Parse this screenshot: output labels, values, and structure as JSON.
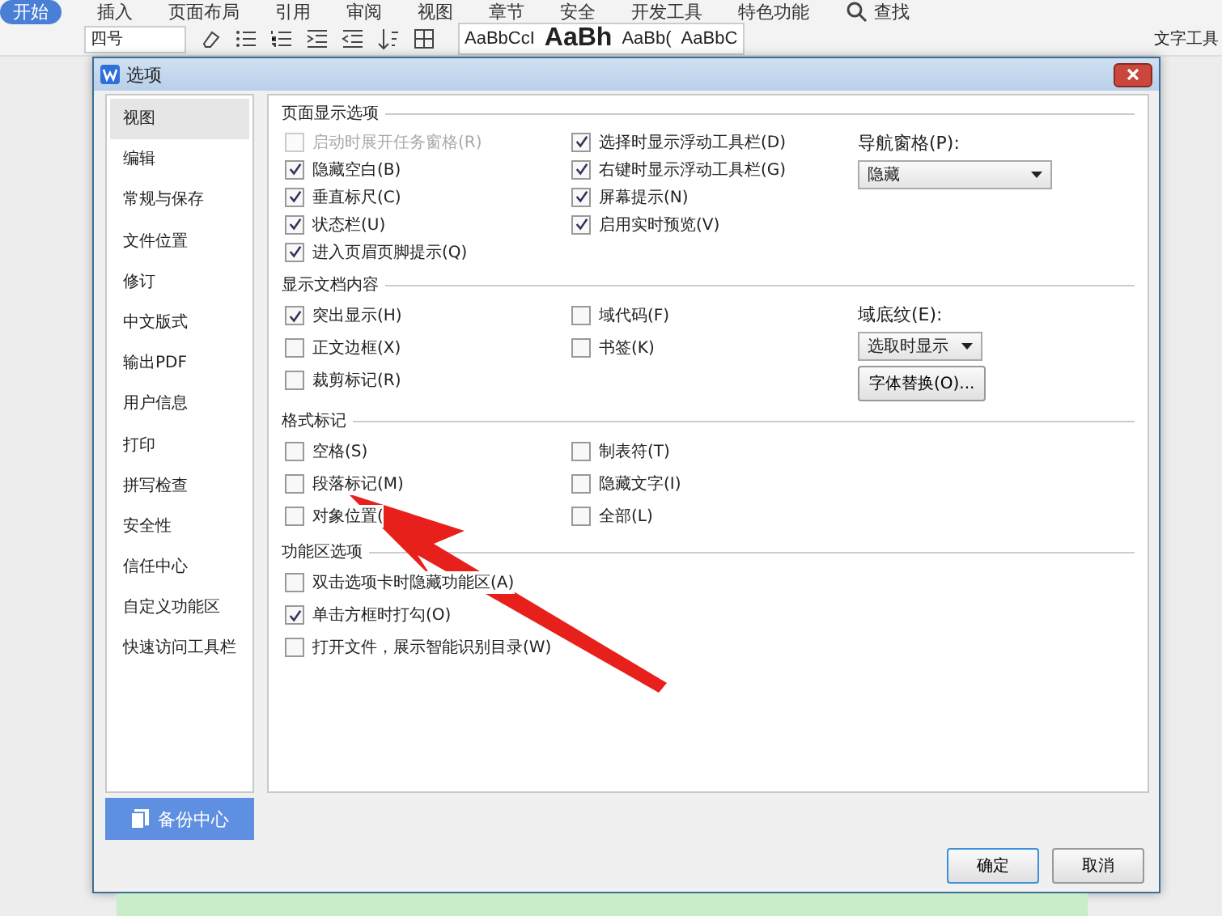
{
  "ribbon": {
    "tabs": [
      {
        "label": "开始",
        "selected": true
      },
      {
        "label": "插入",
        "selected": false
      },
      {
        "label": "页面布局",
        "selected": false
      },
      {
        "label": "引用",
        "selected": false
      },
      {
        "label": "审阅",
        "selected": false
      },
      {
        "label": "视图",
        "selected": false
      },
      {
        "label": "章节",
        "selected": false
      },
      {
        "label": "安全",
        "selected": false
      },
      {
        "label": "开发工具",
        "selected": false
      },
      {
        "label": "特色功能",
        "selected": false
      }
    ],
    "search": "查找",
    "font_size": "四号",
    "styles": [
      "AaBbCcI",
      "AaBh",
      "AaBb(",
      "AaBbC"
    ],
    "tool": "文字工具"
  },
  "dialog": {
    "title": "选项",
    "nav": [
      {
        "label": "视图",
        "selected": true
      },
      {
        "label": "编辑",
        "selected": false
      },
      {
        "label": "常规与保存",
        "selected": false
      },
      {
        "label": "文件位置",
        "selected": false
      },
      {
        "label": "修订",
        "selected": false
      },
      {
        "label": "中文版式",
        "selected": false
      },
      {
        "label": "输出PDF",
        "selected": false
      },
      {
        "label": "用户信息",
        "selected": false
      },
      {
        "label": "打印",
        "selected": false
      },
      {
        "label": "拼写检查",
        "selected": false
      },
      {
        "label": "安全性",
        "selected": false
      },
      {
        "label": "信任中心",
        "selected": false
      },
      {
        "label": "自定义功能区",
        "selected": false
      },
      {
        "label": "快速访问工具栏",
        "selected": false
      }
    ],
    "backup_button": "备份中心",
    "sections": [
      {
        "title": "页面显示选项",
        "columns": [
          [
            {
              "label": "启动时展开任务窗格(R)",
              "checked": false,
              "disabled": true
            },
            {
              "label": "隐藏空白(B)",
              "checked": true,
              "disabled": false
            },
            {
              "label": "垂直标尺(C)",
              "checked": true,
              "disabled": false
            },
            {
              "label": "状态栏(U)",
              "checked": true,
              "disabled": false
            },
            {
              "label": "进入页眉页脚提示(Q)",
              "checked": true,
              "disabled": false
            }
          ],
          [
            {
              "label": "选择时显示浮动工具栏(D)",
              "checked": true,
              "disabled": false
            },
            {
              "label": "右键时显示浮动工具栏(G)",
              "checked": true,
              "disabled": false
            },
            {
              "label": "屏幕提示(N)",
              "checked": true,
              "disabled": false
            },
            {
              "label": "启用实时预览(V)",
              "checked": true,
              "disabled": false
            }
          ]
        ],
        "side": [
          {
            "kind": "label",
            "text": "导航窗格(P):"
          },
          {
            "kind": "dropdown",
            "text": "隐藏"
          }
        ]
      },
      {
        "title": "显示文档内容",
        "columns": [
          [
            {
              "label": "突出显示(H)",
              "checked": true,
              "disabled": false
            },
            {
              "label": "正文边框(X)",
              "checked": false,
              "disabled": false
            },
            {
              "label": "裁剪标记(R)",
              "checked": false,
              "disabled": false
            }
          ],
          [
            {
              "label": "域代码(F)",
              "checked": false,
              "disabled": false
            },
            {
              "label": "书签(K)",
              "checked": false,
              "disabled": false
            }
          ]
        ],
        "side": [
          {
            "kind": "label",
            "text": "域底纹(E):"
          },
          {
            "kind": "dropdown",
            "text": "选取时显示"
          },
          {
            "kind": "button",
            "text": "字体替换(O)..."
          }
        ]
      },
      {
        "title": "格式标记",
        "columns": [
          [
            {
              "label": "空格(S)",
              "checked": false,
              "disabled": false
            },
            {
              "label": "段落标记(M)",
              "checked": false,
              "disabled": false
            },
            {
              "label": "对象位置(",
              "checked": false,
              "disabled": false
            }
          ],
          [
            {
              "label": "制表符(T)",
              "checked": false,
              "disabled": false
            },
            {
              "label": "隐藏文字(I)",
              "checked": false,
              "disabled": false
            },
            {
              "label": "全部(L)",
              "checked": false,
              "disabled": false
            }
          ]
        ]
      },
      {
        "title": "功能区选项",
        "columns": [
          [
            {
              "label": "双击选项卡时隐藏功能区(A)",
              "checked": false,
              "disabled": false
            },
            {
              "label": "单击方框时打勾(O)",
              "checked": true,
              "disabled": false
            },
            {
              "label": "打开文件，展示智能识别目录(W)",
              "checked": false,
              "disabled": false
            }
          ]
        ]
      }
    ],
    "buttons": [
      {
        "label": "确定",
        "kind": "default"
      },
      {
        "label": "取消",
        "kind": "normal"
      }
    ]
  }
}
